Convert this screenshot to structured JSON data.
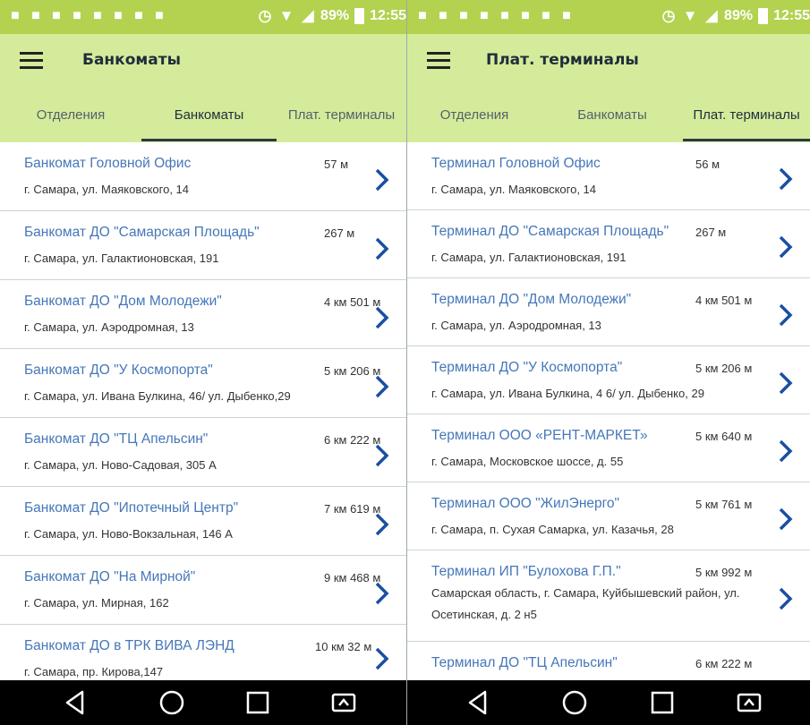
{
  "left": {
    "status": {
      "battery": "89%",
      "time": "12:55"
    },
    "title": "Банкоматы",
    "tabs": [
      "Отделения",
      "Банкоматы",
      "Плат. терминалы"
    ],
    "active_tab": 1,
    "items": [
      {
        "title": "Банкомат Головной Офис",
        "distance": "57 м",
        "address": "г. Самара, ул. Маяковского, 14"
      },
      {
        "title": "Банкомат ДО \"Самарская Площадь\"",
        "distance": "267 м",
        "address": "г. Самара, ул. Галактионовская, 191"
      },
      {
        "title": "Банкомат ДО \"Дом Молодежи\"",
        "distance": "4 км 501 м",
        "address": "г. Самара, ул. Аэродромная, 13"
      },
      {
        "title": "Банкомат ДО \"У Космопорта\"",
        "distance": "5 км 206 м",
        "address": "г. Самара, ул. Ивана Булкина, 46/ ул. Дыбенко,29"
      },
      {
        "title": "Банкомат ДО \"ТЦ Апельсин\"",
        "distance": "6 км 222 м",
        "address": "г. Самара, ул. Ново-Садовая, 305 А"
      },
      {
        "title": "Банкомат ДО \"Ипотечный Центр\"",
        "distance": "7 км 619 м",
        "address": "г. Самара, ул. Ново-Вокзальная, 146 А"
      },
      {
        "title": "Банкомат ДО \"На Мирной\"",
        "distance": "9 км 468 м",
        "address": "г. Самара, ул. Мирная, 162"
      },
      {
        "title": "Банкомат ДО в ТРК ВИВА ЛЭНД",
        "distance": "10 км 32 м",
        "address": "г. Самара, пр. Кирова,147"
      }
    ]
  },
  "right": {
    "status": {
      "battery": "89%",
      "time": "12:55"
    },
    "title": "Плат. терминалы",
    "tabs": [
      "Отделения",
      "Банкоматы",
      "Плат. терминалы"
    ],
    "active_tab": 2,
    "items": [
      {
        "title": "Терминал Головной Офис",
        "distance": "56 м",
        "address": "г. Самара, ул. Маяковского, 14"
      },
      {
        "title": "Терминал ДО \"Самарская Площадь\"",
        "distance": "267 м",
        "address": "г. Самара, ул. Галактионовская, 191"
      },
      {
        "title": "Терминал ДО \"Дом Молодежи\"",
        "distance": "4 км 501 м",
        "address": "г. Самара, ул. Аэродромная, 13"
      },
      {
        "title": "Терминал ДО \"У Космопорта\"",
        "distance": "5 км 206 м",
        "address": "г. Самара, ул. Ивана Булкина, 4 6/ ул. Дыбенко, 29"
      },
      {
        "title": "Терминал ООО «РЕНТ-МАРКЕТ»",
        "distance": "5 км 640 м",
        "address": "г. Самара, Московское шоссе, д. 55"
      },
      {
        "title": "Терминал ООО \"ЖилЭнерго\"",
        "distance": "5 км 761 м",
        "address": "г. Самара, п. Сухая Самарка, ул. Казачья, 28"
      },
      {
        "title": "Терминал ИП \"Булохова Г.П.\"",
        "distance": "5 км 992 м",
        "address": "Самарская область, г. Самара, Куйбышевский район, ул. Осетинская, д. 2 н5"
      },
      {
        "title": "Терминал ДО \"ТЦ Апельсин\"",
        "distance": "6 км 222 м",
        "address": ""
      }
    ]
  },
  "icons": {
    "menu": "hamburger-menu-icon",
    "chevron": "chevron-right-icon",
    "nav": [
      "back-icon",
      "home-icon",
      "recents-icon",
      "screen-share-icon"
    ]
  },
  "colors": {
    "statusbar": "#b3d24f",
    "appbar": "#d4eb9c",
    "title_link": "#4577b8",
    "chevron": "#1a4fa0"
  }
}
